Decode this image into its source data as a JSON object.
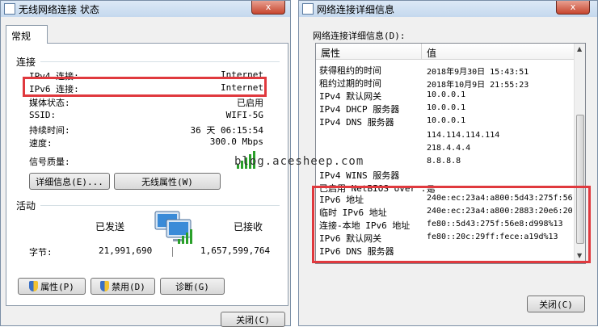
{
  "left_window": {
    "title": "无线网络连接 状态",
    "close_label": "x",
    "tab": "常规",
    "connection_section": "连接",
    "rows": [
      {
        "label": "IPv4 连接:",
        "value": "Internet"
      },
      {
        "label": "IPv6 连接:",
        "value": "Internet"
      },
      {
        "label": "媒体状态:",
        "value": "已启用"
      },
      {
        "label": "SSID:",
        "value": "WIFI-5G"
      },
      {
        "label": "持续时间:",
        "value": "36 天 06:15:54"
      },
      {
        "label": "速度:",
        "value": "300.0 Mbps"
      }
    ],
    "signal_label": "信号质量:",
    "details_button": "详细信息(E)...",
    "wireless_props_button": "无线属性(W)",
    "activity_section": "活动",
    "sent_label": "已发送",
    "received_label": "已接收",
    "bytes_label": "字节:",
    "bytes_sent": "21,991,690",
    "bytes_received": "1,657,599,764",
    "properties_button": "属性(P)",
    "disable_button": "禁用(D)",
    "diagnose_button": "诊断(G)",
    "close_button": "关闭(C)"
  },
  "right_window": {
    "title": "网络连接详细信息",
    "close_label": "x",
    "list_caption": "网络连接详细信息(D):",
    "col_property": "属性",
    "col_value": "值",
    "rows": [
      {
        "p": "获得租约的时间",
        "v": "2018年9月30日 15:43:51"
      },
      {
        "p": "租约过期的时间",
        "v": "2018年10月9日 21:55:23"
      },
      {
        "p": "IPv4 默认网关",
        "v": "10.0.0.1"
      },
      {
        "p": "IPv4 DHCP 服务器",
        "v": "10.0.0.1"
      },
      {
        "p": "IPv4 DNS 服务器",
        "v": "10.0.0.1"
      },
      {
        "p": "",
        "v": "114.114.114.114"
      },
      {
        "p": "",
        "v": "218.4.4.4"
      },
      {
        "p": "",
        "v": "8.8.8.8"
      },
      {
        "p": "IPv4 WINS 服务器",
        "v": ""
      },
      {
        "p": "已启用 NetBIOS over ...",
        "v": "是"
      },
      {
        "p": "IPv6 地址",
        "v": "240e:ec:23a4:a800:5d43:275f:56"
      },
      {
        "p": "临时 IPv6 地址",
        "v": "240e:ec:23a4:a800:2883:20e6:20"
      },
      {
        "p": "连接-本地 IPv6 地址",
        "v": "fe80::5d43:275f:56e8:d998%13"
      },
      {
        "p": "IPv6 默认网关",
        "v": "fe80::20c:29ff:fece:a19d%13"
      },
      {
        "p": "IPv6 DNS 服务器",
        "v": ""
      }
    ],
    "close_button": "关闭(C)"
  },
  "watermark": "blog.acesheep.com",
  "accent": {
    "highlight_box": "#e0393e",
    "title_bar": "#c4d8ee"
  }
}
